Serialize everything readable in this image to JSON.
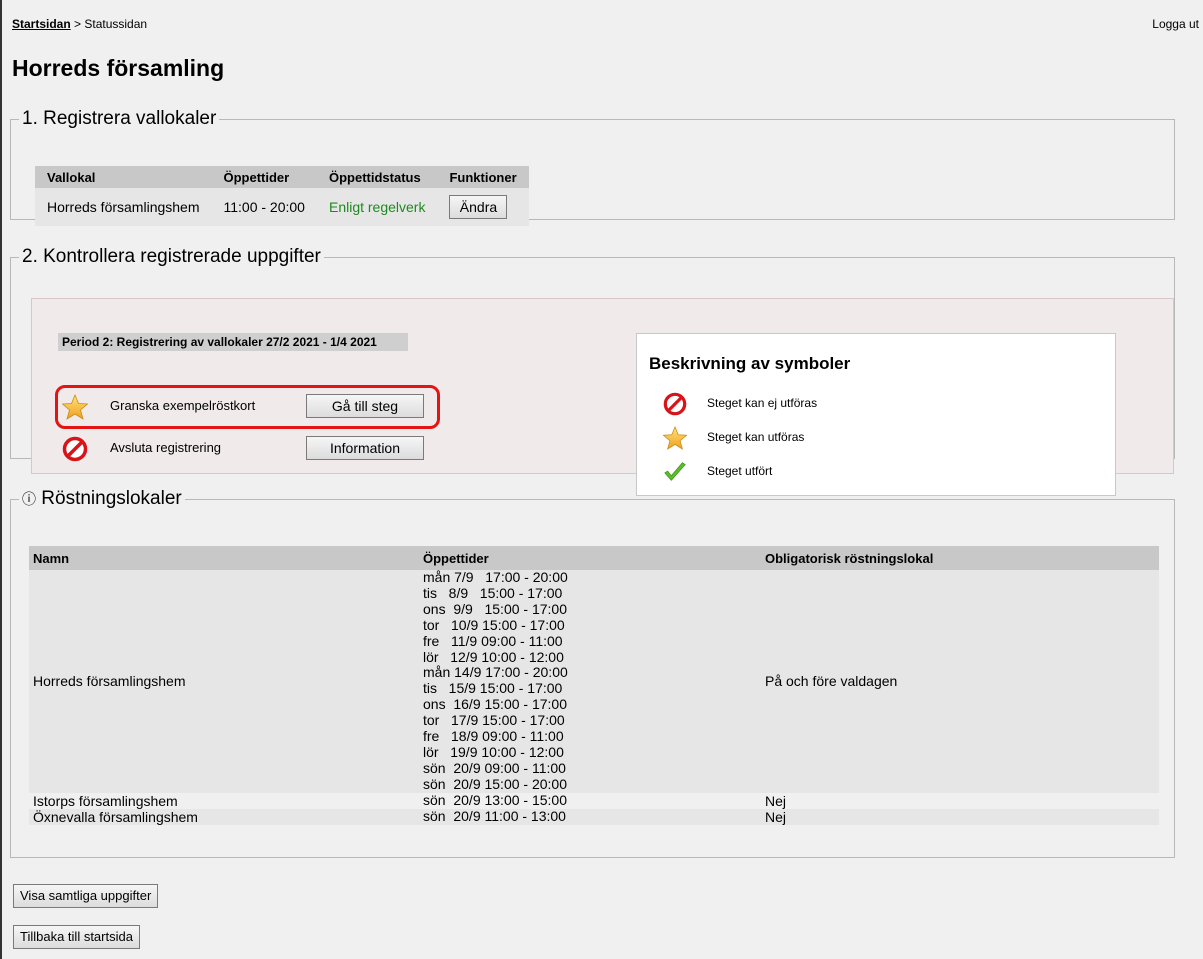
{
  "breadcrumb": {
    "home": "Startsidan",
    "separator": " > ",
    "current": "Statussidan"
  },
  "header": {
    "logout": "Logga ut"
  },
  "page_title": "Horreds församling",
  "section1": {
    "legend": "1. Registrera vallokaler",
    "columns": [
      "Vallokal",
      "Öppettider",
      "Öppettidstatus",
      "Funktioner"
    ],
    "row": {
      "name": "Horreds församlingshem",
      "hours": "11:00 - 20:00",
      "status": "Enligt regelverk",
      "button": "Ändra"
    },
    "status_color": "#1e8a1e"
  },
  "section2": {
    "legend": "2. Kontrollera registrerade uppgifter",
    "period": "Period 2: Registrering av vallokaler 27/2 2021 - 1/4 2021",
    "steps": [
      {
        "icon": "star-icon",
        "label": "Granska exempelröstkort",
        "button": "Gå till steg"
      },
      {
        "icon": "forbidden-icon",
        "label": "Avsluta registrering",
        "button": "Information"
      }
    ],
    "highlight_color": "#e41414",
    "symbols": {
      "title": "Beskrivning av symboler",
      "items": [
        {
          "icon": "forbidden-icon",
          "label": "Steget kan ej utföras"
        },
        {
          "icon": "star-icon",
          "label": "Steget kan utföras"
        },
        {
          "icon": "checkmark-icon",
          "label": "Steget utfört"
        }
      ]
    }
  },
  "section3": {
    "legend_icon": "ⓘ",
    "legend": "Röstningslokaler",
    "columns": [
      "Namn",
      "Öppettider",
      "Obligatorisk röstningslokal"
    ],
    "rows": [
      {
        "name": "Horreds församlingshem",
        "times": [
          "mån 7/9   17:00 - 20:00",
          "tis   8/9   15:00 - 17:00",
          "ons  9/9   15:00 - 17:00",
          "tor   10/9 15:00 - 17:00",
          "fre   11/9 09:00 - 11:00",
          "lör   12/9 10:00 - 12:00",
          "mån 14/9 17:00 - 20:00",
          "tis   15/9 15:00 - 17:00",
          "ons  16/9 15:00 - 17:00",
          "tor   17/9 15:00 - 17:00",
          "fre   18/9 09:00 - 11:00",
          "lör   19/9 10:00 - 12:00",
          "sön  20/9 09:00 - 11:00",
          "sön  20/9 15:00 - 20:00"
        ],
        "mandatory": "På och före valdagen"
      },
      {
        "name": "Istorps församlingshem",
        "times": [
          "sön  20/9 13:00 - 15:00"
        ],
        "mandatory": "Nej"
      },
      {
        "name": "Öxnevalla församlingshem",
        "times": [
          "sön  20/9 11:00 - 13:00"
        ],
        "mandatory": "Nej"
      }
    ]
  },
  "buttons": {
    "show_all": "Visa samtliga uppgifter",
    "back": "Tillbaka till startsida"
  }
}
